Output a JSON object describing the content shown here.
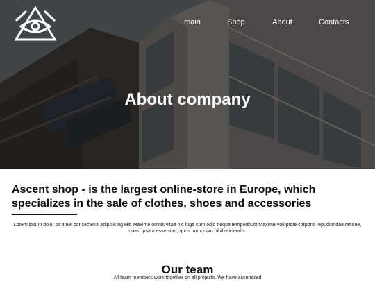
{
  "nav": {
    "items": [
      {
        "label": "main"
      },
      {
        "label": "Shop"
      },
      {
        "label": "About"
      },
      {
        "label": "Contacts"
      }
    ]
  },
  "hero": {
    "title": "About company"
  },
  "intro": {
    "headline": "Ascent shop - is the largest online-store in Europe, which specializes in the sale of clothes, shoes and accessories",
    "body": "Lorem ipsum dolor sit amet consectetur adipisicing elit. Maxime omnis vitae hic fuga cum odio neque temporibus! Maxime voluptate corporis repudiandae ratione, quasi ipsam esse sunt, quos numquam nihil reiciendis."
  },
  "team": {
    "title": "Our team",
    "subtitle": "All team members work together on all projects. We have assembled"
  },
  "icons": {
    "logo": "eye-triangle-logo"
  },
  "colors": {
    "hero_overlay": "#4f5659",
    "text": "#111111",
    "nav_text": "#ffffff"
  }
}
